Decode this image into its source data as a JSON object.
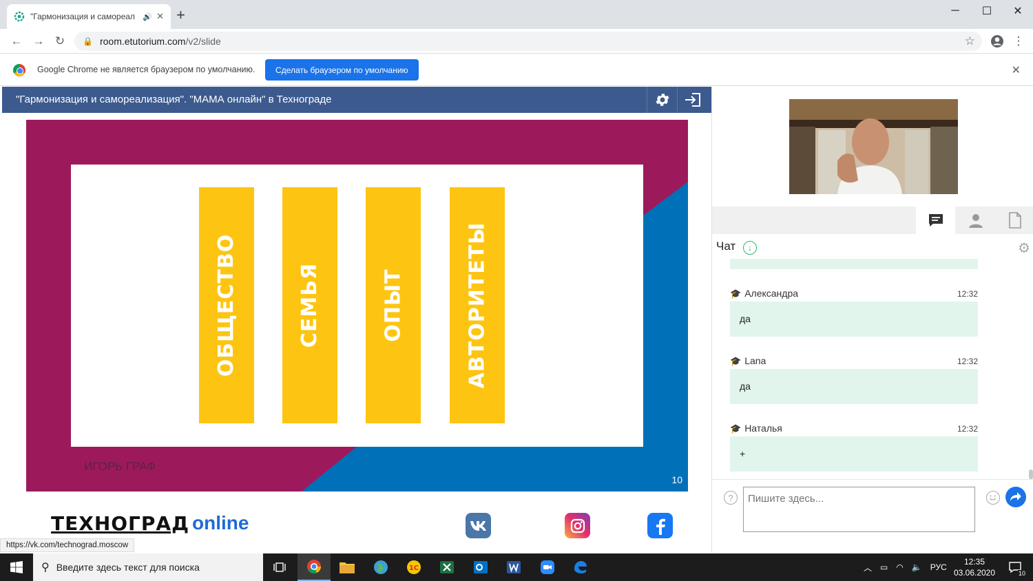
{
  "browser": {
    "tab_title": "\"Гармонизация и самореал",
    "url_host": "room.etutorium.com",
    "url_path": "/v2/slide",
    "infobar_message": "Google Chrome не является браузером по умолчанию.",
    "infobar_button": "Сделать браузером по умолчанию",
    "status_url": "https://vk.com/technograd.moscow"
  },
  "room": {
    "title": "\"Гармонизация и самореализация\". \"МАМА онлайн\" в Технограде"
  },
  "slide": {
    "bars": [
      "ОБЩЕСТВО",
      "СЕМЬЯ",
      "ОПЫТ",
      "АВТОРИТЕТЫ"
    ],
    "author": "ИГОРЬ ГРАФ",
    "page_number": "10",
    "colors": {
      "magenta": "#9c1a5c",
      "blue": "#0070b8",
      "yellow": "#fdc512"
    }
  },
  "footer": {
    "brand_main": "ТЕХНОГРАД",
    "brand_suffix": "online",
    "social": {
      "vk": "vk-icon",
      "instagram": "instagram-icon",
      "facebook": "facebook-icon"
    }
  },
  "chat": {
    "title": "Чат",
    "input_placeholder": "Пишите здесь...",
    "messages": [
      {
        "author": "Александра",
        "time": "12:32",
        "text": "да"
      },
      {
        "author": "Lana",
        "time": "12:32",
        "text": "да"
      },
      {
        "author": "Наталья",
        "time": "12:32",
        "text": "+"
      }
    ]
  },
  "taskbar": {
    "search_placeholder": "Введите здесь текст для поиска",
    "language": "РУС",
    "time": "12:35",
    "date": "03.06.2020",
    "notification_count": "10"
  }
}
